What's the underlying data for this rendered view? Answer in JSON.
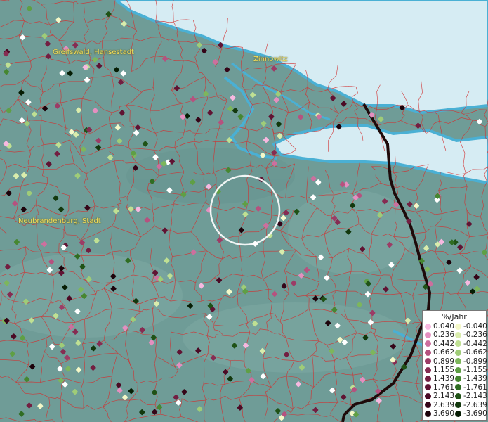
{
  "map": {
    "cities": [
      {
        "id": "greifswald",
        "name": "Greifswald, Hansestadt"
      },
      {
        "id": "zinnowitz",
        "name": "Zinnowitz"
      },
      {
        "id": "neubrandenburg",
        "name": "Neubrandenburg, Stadt"
      }
    ],
    "colors": {
      "land": "#6f9c97",
      "water": "#d6ecf3",
      "water_edge": "#4ab0d4",
      "boundaries": "#d23030",
      "border_line": "#1e0a0a",
      "label": "#f2e060",
      "highlight_ring": "#ffffff"
    }
  },
  "legend": {
    "title": "%/Jahr",
    "positive": [
      {
        "value": "0.040",
        "color": "#f7b8e0"
      },
      {
        "value": "0.236",
        "color": "#e48fc0"
      },
      {
        "value": "0.442",
        "color": "#cd6f9e"
      },
      {
        "value": "0.662",
        "color": "#b5527f"
      },
      {
        "value": "0.899",
        "color": "#9c3c66"
      },
      {
        "value": "1.155",
        "color": "#862c52"
      },
      {
        "value": "1.439",
        "color": "#731e41"
      },
      {
        "value": "1.761",
        "color": "#601333"
      },
      {
        "value": "2.143",
        "color": "#4b0a25"
      },
      {
        "value": "2.639",
        "color": "#350518"
      },
      {
        "value": "3.690",
        "color": "#1c020a"
      }
    ],
    "negative": [
      {
        "value": "-0.040",
        "color": "#f4f8c8"
      },
      {
        "value": "-0.236",
        "color": "#d9ecac"
      },
      {
        "value": "-0.442",
        "color": "#bfe093"
      },
      {
        "value": "-0.662",
        "color": "#9fcc78"
      },
      {
        "value": "-0.899",
        "color": "#7db65c"
      },
      {
        "value": "-1.155",
        "color": "#5f9f45"
      },
      {
        "value": "-1.439",
        "color": "#468731"
      },
      {
        "value": "-1.761",
        "color": "#2f6d22"
      },
      {
        "value": "-2.143",
        "color": "#1f5216"
      },
      {
        "value": "-2.639",
        "color": "#12380d"
      },
      {
        "value": "-3.690",
        "color": "#061d04"
      }
    ]
  }
}
